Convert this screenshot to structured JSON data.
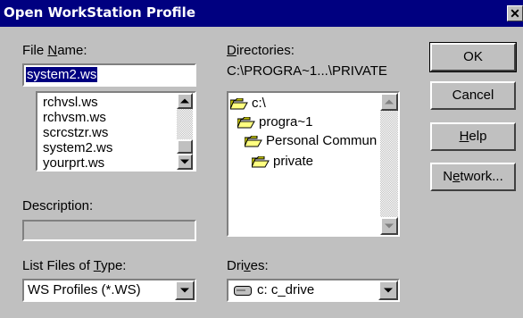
{
  "window": {
    "title": "Open WorkStation Profile",
    "close_glyph": "✕"
  },
  "file_name": {
    "label_prefix": "File ",
    "label_accel": "N",
    "label_suffix": "ame:",
    "value": "system2.ws",
    "files": [
      "rchvsl.ws",
      "rchvsm.ws",
      "scrcstzr.ws",
      "system2.ws",
      "yourprt.ws"
    ]
  },
  "directories": {
    "label_accel": "D",
    "label_suffix": "irectories:",
    "current_path": "C:\\PROGRA~1...\\PRIVATE",
    "items": [
      {
        "name": "c:\\",
        "icon": "open-folder-icon"
      },
      {
        "name": "progra~1",
        "icon": "open-folder-icon"
      },
      {
        "name": "Personal Commun",
        "icon": "open-folder-icon"
      },
      {
        "name": "private",
        "icon": "open-folder-icon"
      }
    ]
  },
  "description": {
    "label": "Description:",
    "value": ""
  },
  "file_type": {
    "label_prefix": "List Files of ",
    "label_accel": "T",
    "label_suffix": "ype:",
    "selected": "WS Profiles (*.WS)"
  },
  "drives": {
    "label_prefix": "Dri",
    "label_accel": "v",
    "label_suffix": "es:",
    "selected": "c: c_drive",
    "icon": "hard-drive-icon"
  },
  "buttons": {
    "ok": "OK",
    "cancel": "Cancel",
    "help_accel": "H",
    "help_suffix": "elp",
    "network_prefix": "N",
    "network_accel": "e",
    "network_suffix": "twork..."
  },
  "colors": {
    "titlebar": "#000080",
    "face": "#c0c0c0",
    "selection": "#000080"
  }
}
